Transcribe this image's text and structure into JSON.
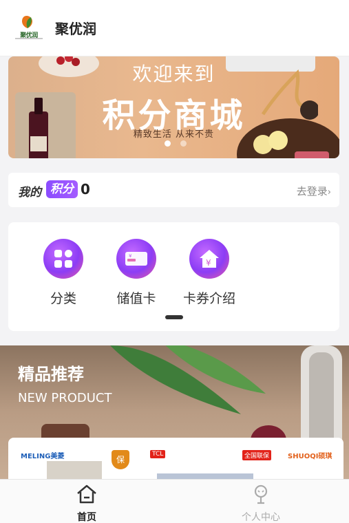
{
  "header": {
    "logo_text": "聚优润",
    "title": "聚优润"
  },
  "banner": {
    "headline_1": "欢迎来到",
    "headline_2": "积分商城",
    "subtitle": "精致生活 从来不贵",
    "dots": 2,
    "active_dot": 1
  },
  "points": {
    "label": "我的",
    "badge": "积分",
    "value": "0",
    "login_link": "去登录"
  },
  "menu": {
    "items": [
      {
        "label": "分类",
        "icon": "category-grid-icon"
      },
      {
        "label": "储值卡",
        "icon": "stored-value-card-icon"
      },
      {
        "label": "卡券介绍",
        "icon": "coupon-house-icon"
      }
    ]
  },
  "promo": {
    "title": "精品推荐",
    "subtitle": "NEW PRODUCT",
    "brands": [
      "MELING美菱",
      "TCL",
      "SHUOQI硕琪"
    ],
    "tag": "全国联保"
  },
  "tabbar": {
    "items": [
      {
        "label": "首页",
        "icon": "home-icon",
        "active": true
      },
      {
        "label": "个人中心",
        "icon": "profile-icon",
        "active": false
      }
    ]
  },
  "colors": {
    "accent_purple": "#8c3df5",
    "brand_green": "#2f6b2f",
    "promo_brown": "#b99c84"
  }
}
